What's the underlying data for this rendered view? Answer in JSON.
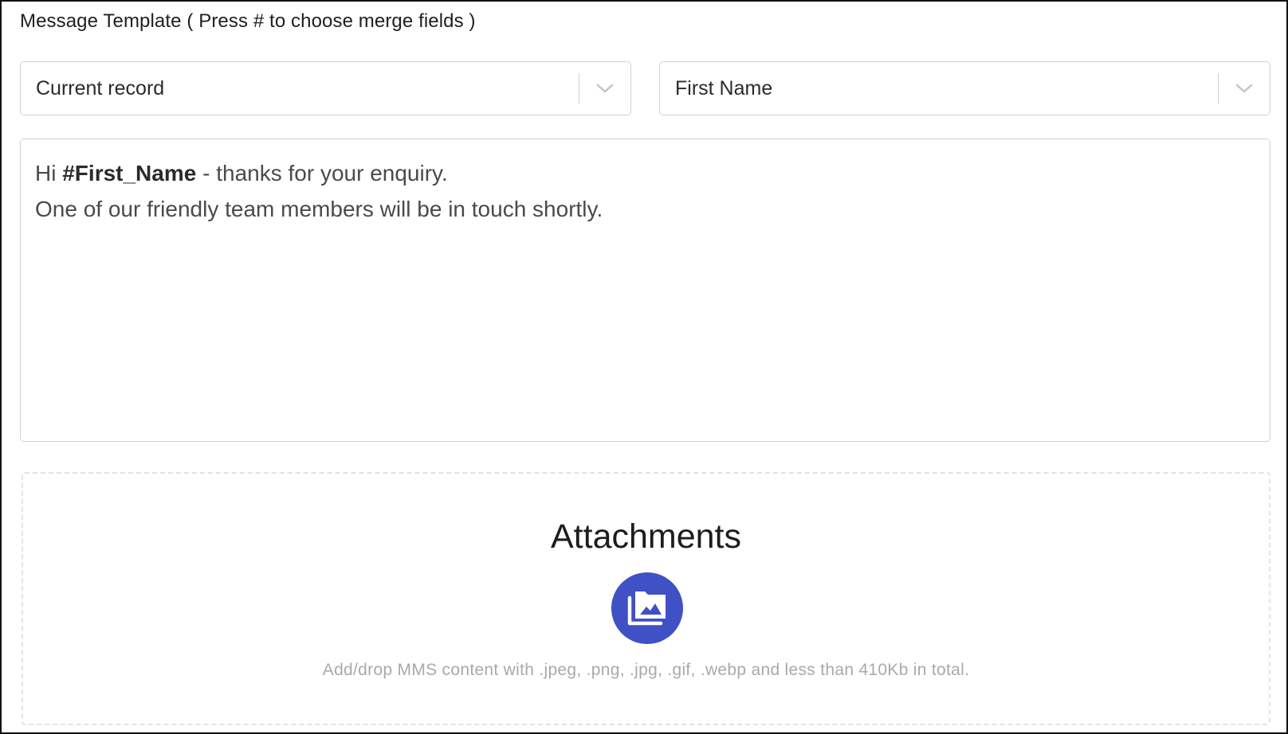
{
  "section": {
    "label": "Message Template ( Press # to choose merge fields )"
  },
  "selects": {
    "source": {
      "value": "Current record",
      "icon": "chevron-down-icon"
    },
    "field": {
      "value": "First Name",
      "icon": "chevron-down-icon"
    }
  },
  "editor": {
    "line1_prefix": "Hi ",
    "line1_merge": "#First_Name",
    "line1_suffix": " - thanks for your enquiry.",
    "line2": "One of our friendly team members will be in touch shortly."
  },
  "attachments": {
    "title": "Attachments",
    "icon": "image-folder-icon",
    "icon_color": "#3f51c4",
    "hint": "Add/drop MMS content with .jpeg, .png, .jpg, .gif, .webp and less than 410Kb in total."
  }
}
